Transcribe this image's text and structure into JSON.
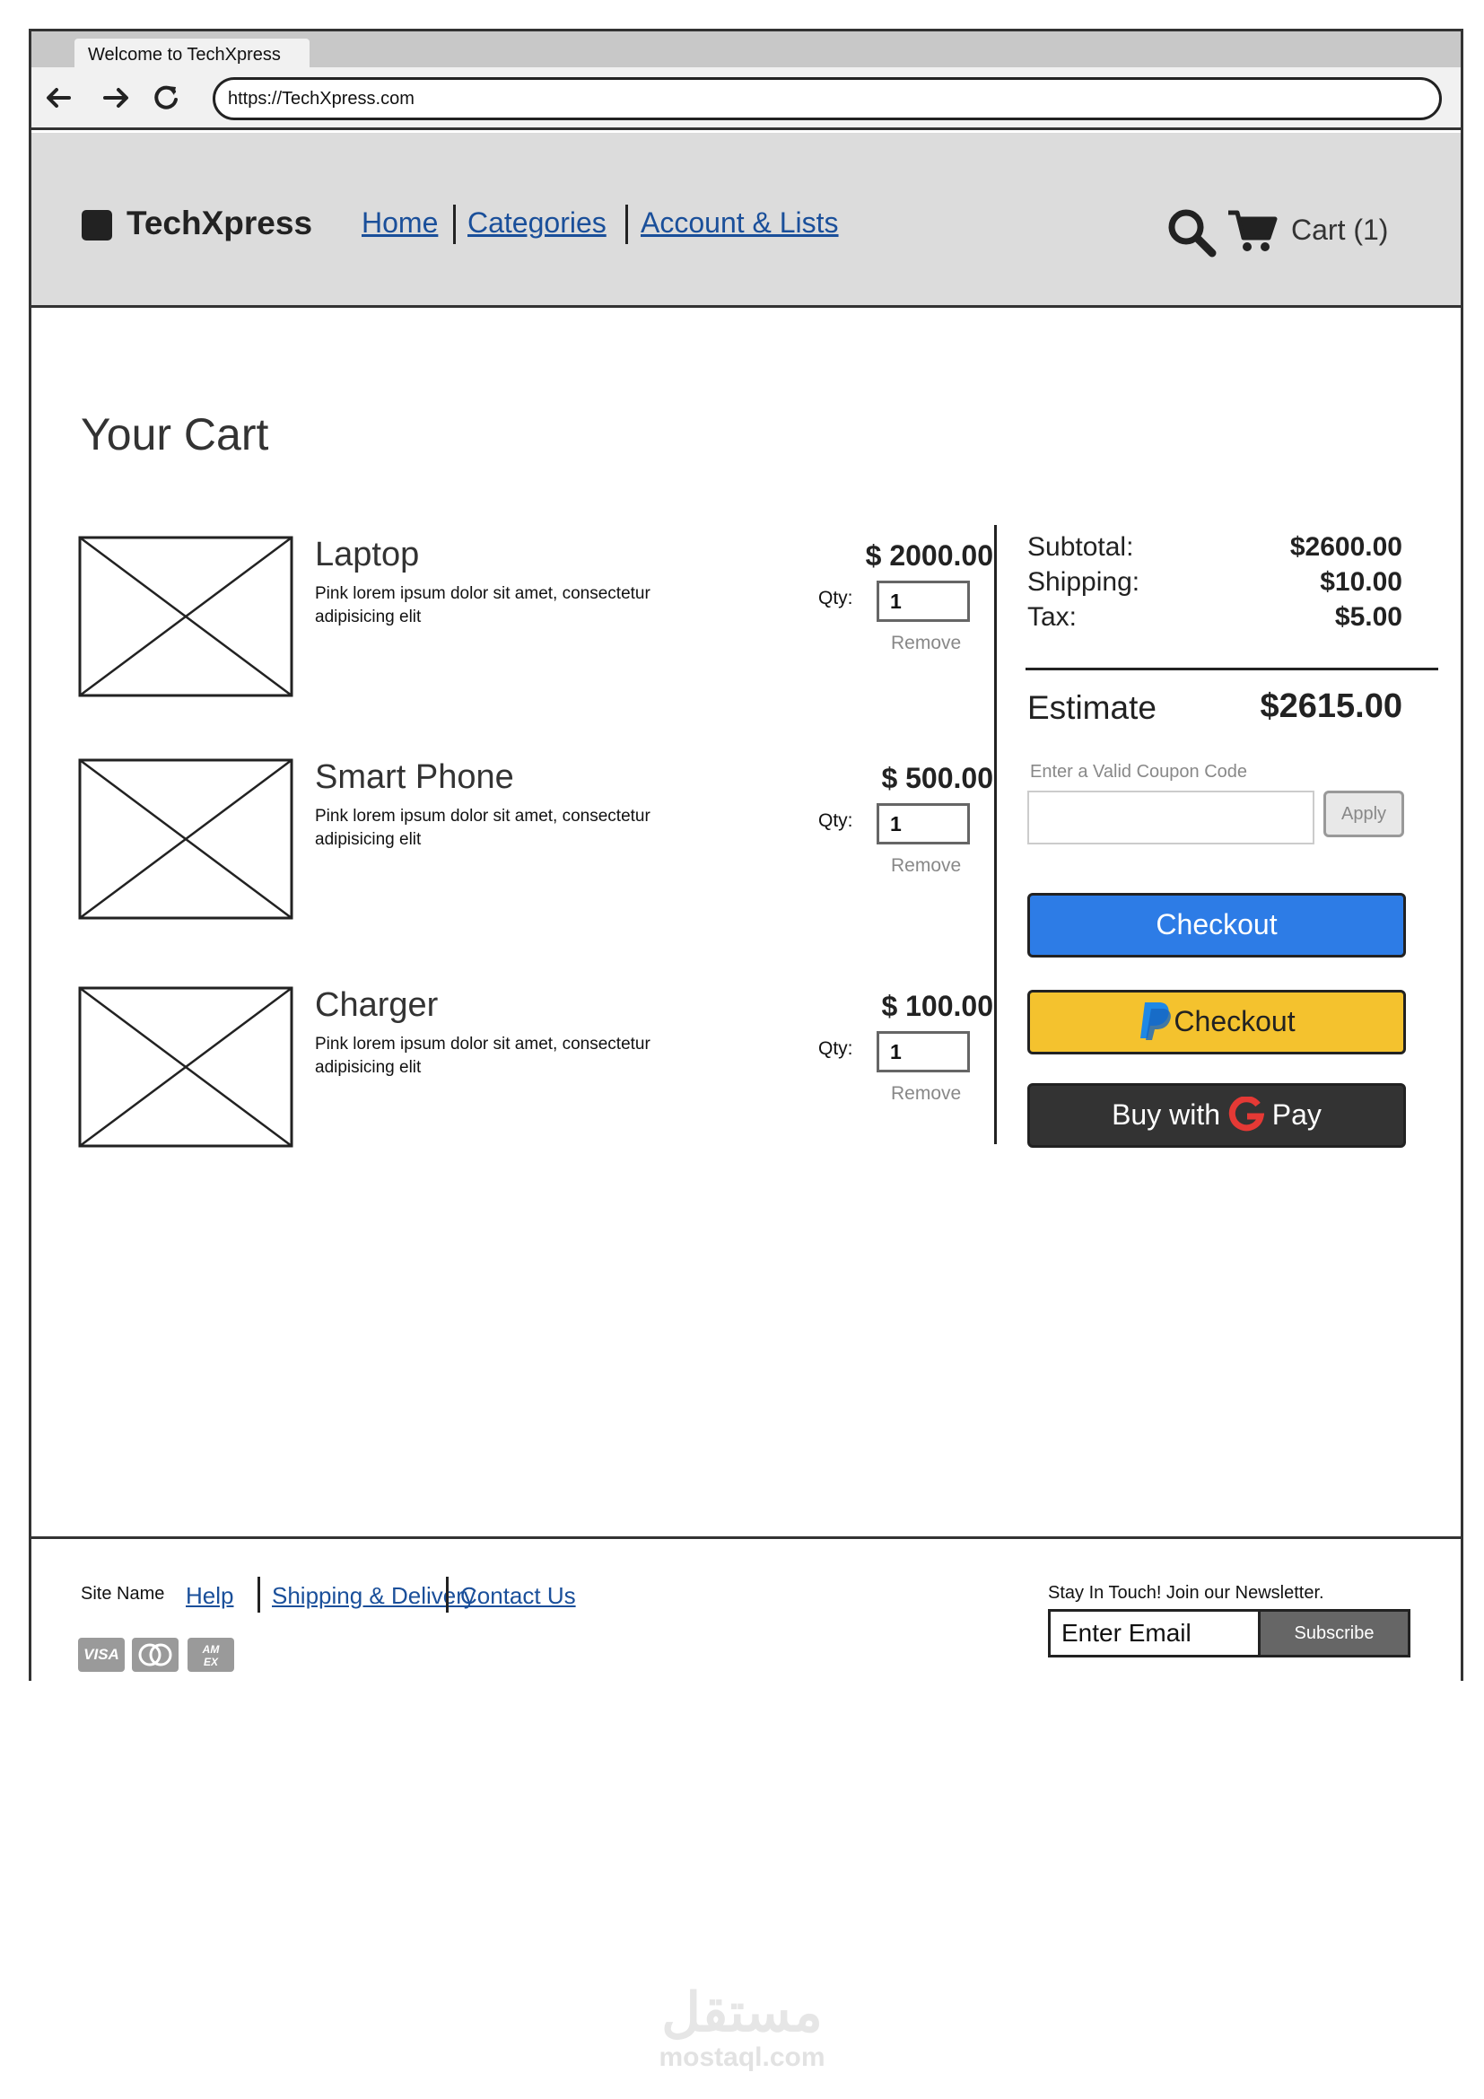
{
  "browser": {
    "tab_title": "Welcome to TechXpress",
    "url": "https://TechXpress.com"
  },
  "header": {
    "logo": "TechXpress",
    "nav": [
      "Home",
      "Categories",
      "Account & Lists"
    ],
    "cart_label": "Cart (1)"
  },
  "page_title": "Your Cart",
  "cart": {
    "qty_label": "Qty:",
    "remove_label": "Remove",
    "items": [
      {
        "name": "Laptop",
        "description": "Pink lorem ipsum dolor sit amet, consectetur adipisicing elit",
        "price": "$ 2000.00",
        "qty": "1"
      },
      {
        "name": "Smart Phone",
        "description": "Pink lorem ipsum dolor sit amet, consectetur adipisicing elit",
        "price": "$ 500.00",
        "qty": "1"
      },
      {
        "name": "Charger",
        "description": "Pink lorem ipsum dolor sit amet, consectetur adipisicing elit",
        "price": "$ 100.00",
        "qty": "1"
      }
    ]
  },
  "summary": {
    "subtotal_label": "Subtotal:",
    "subtotal_value": "$2600.00",
    "shipping_label": "Shipping:",
    "shipping_value": "$10.00",
    "tax_label": "Tax:",
    "tax_value": "$5.00",
    "estimate_label": "Estimate",
    "estimate_value": "$2615.00",
    "coupon_label": "Enter a Valid Coupon Code",
    "apply_label": "Apply",
    "checkout_label": "Checkout",
    "paypal_label": "Checkout",
    "gpay_prefix": "Buy with",
    "gpay_suffix": "Pay"
  },
  "footer": {
    "site_name": "Site Name",
    "links": [
      "Help",
      "Shipping & Delivery",
      "Contact Us"
    ],
    "cards": [
      "VISA",
      "mastercard-icon",
      "amex-icon"
    ],
    "newsletter_label": "Stay In Touch! Join our Newsletter.",
    "email_placeholder": "Enter Email",
    "subscribe_label": "Subscribe"
  },
  "watermark": {
    "arabic": "مستقل",
    "latin": "mostaql.com"
  },
  "colors": {
    "checkout": "#2d7ce6",
    "paypal": "#f4c22e",
    "gpay": "#333333",
    "link": "#1a4f9a",
    "google_red": "#e53935",
    "paypal_blue": "#1e88e5"
  }
}
